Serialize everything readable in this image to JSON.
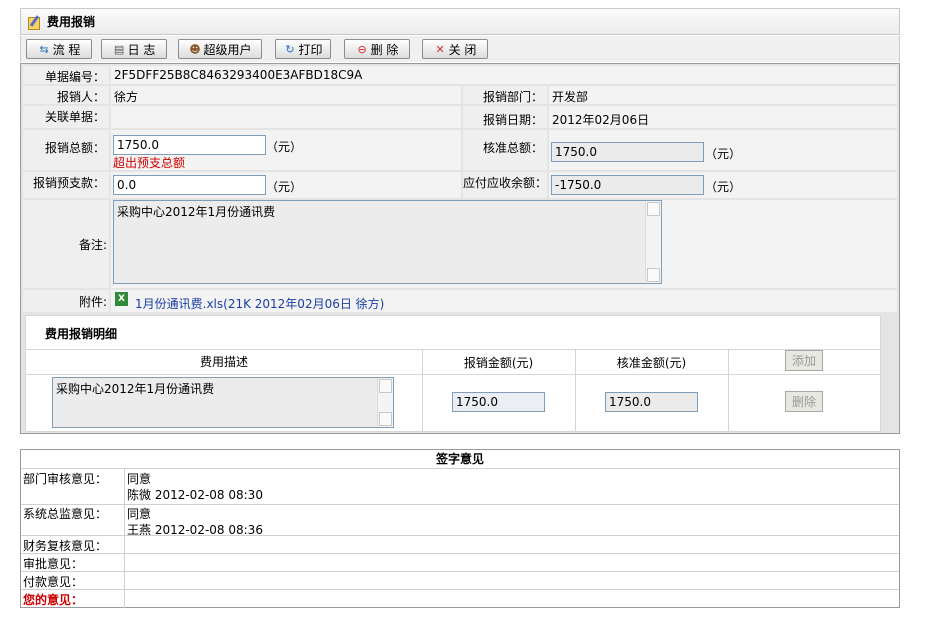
{
  "window": {
    "title": "费用报销"
  },
  "toolbar": {
    "flow": "流 程",
    "log": "日 志",
    "superuser": "超级用户",
    "print": "打印",
    "delete": "删 除",
    "close": "关 闭"
  },
  "form": {
    "doc_no_label": "单据编号：",
    "doc_no": "2F5DFF25B8C8463293400E3AFBD18C9A",
    "applicant_label": "报销人：",
    "applicant": "徐方",
    "dept_label": "报销部门：",
    "dept": "开发部",
    "related_label": "关联单据：",
    "date_label": "报销日期：",
    "date": "2012年02月06日",
    "total_label": "报销总额：",
    "total": "1750.0",
    "over_budget": "超出预支总额",
    "approved_total_label": "核准总额：",
    "approved_total": "1750.0",
    "advance_label": "报销预支款：",
    "advance": "0.0",
    "payable_label": "应付应收余额：",
    "payable": "-1750.0",
    "unit": "（元）",
    "remark_label": "备注:",
    "remark": "采购中心2012年1月份通讯费",
    "attachment_label": "附件:",
    "attachment": "1月份通讯费.xls(21K 2012年02月06日 徐方)"
  },
  "detail": {
    "title": "费用报销明细",
    "col_desc": "费用描述",
    "col_amount": "报销金额(元)",
    "col_approved": "核准金额(元)",
    "add_label": "添加",
    "delete_label": "删除",
    "rows": [
      {
        "desc": "采购中心2012年1月份通讯费",
        "amount": "1750.0",
        "approved": "1750.0"
      }
    ]
  },
  "signoff": {
    "title": "签字意见",
    "rows": [
      {
        "label": "部门审核意见：",
        "opinion": "同意",
        "signer": "陈微  2012-02-08 08:30"
      },
      {
        "label": "系统总监意见：",
        "opinion": "同意",
        "signer": "王燕  2012-02-08 08:36"
      },
      {
        "label": "财务复核意见："
      },
      {
        "label": "审批意见："
      },
      {
        "label": "付款意见："
      },
      {
        "label": "您的意见："
      }
    ]
  },
  "colors": {
    "highlight_red": "#cc0000",
    "link_blue": "#1a3ea6"
  }
}
